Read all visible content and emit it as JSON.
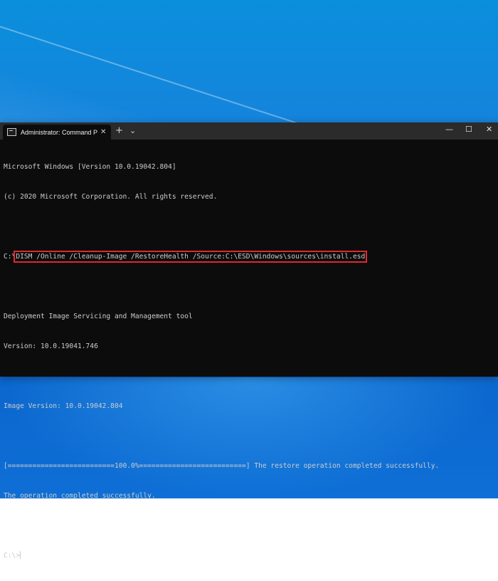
{
  "window": {
    "tab_title": "Administrator: Command Prompt",
    "tab_close": "✕",
    "new_tab": "+",
    "tab_dropdown": "⌄",
    "minimize": "—",
    "maximize": "☐",
    "close": "✕"
  },
  "console": {
    "line1": "Microsoft Windows [Version 10.0.19042.804]",
    "line2": "(c) 2020 Microsoft Corporation. All rights reserved.",
    "prompt1": "C:\\",
    "command": "DISM /Online /Cleanup-Image /RestoreHealth /Source:C:\\ESD\\Windows\\sources\\install.esd",
    "tool_name": "Deployment Image Servicing and Management tool",
    "tool_version": "Version: 10.0.19041.746",
    "image_version": "Image Version: 10.0.19042.804",
    "progress_line": "[==========================100.0%==========================] The restore operation completed successfully.",
    "completed": "The operation completed successfully.",
    "prompt2": "C:\\>"
  },
  "colors": {
    "console_bg": "#0c0c0c",
    "console_text": "#cccccc",
    "highlight": "#e0282e",
    "desktop": "#0a6fd6"
  }
}
